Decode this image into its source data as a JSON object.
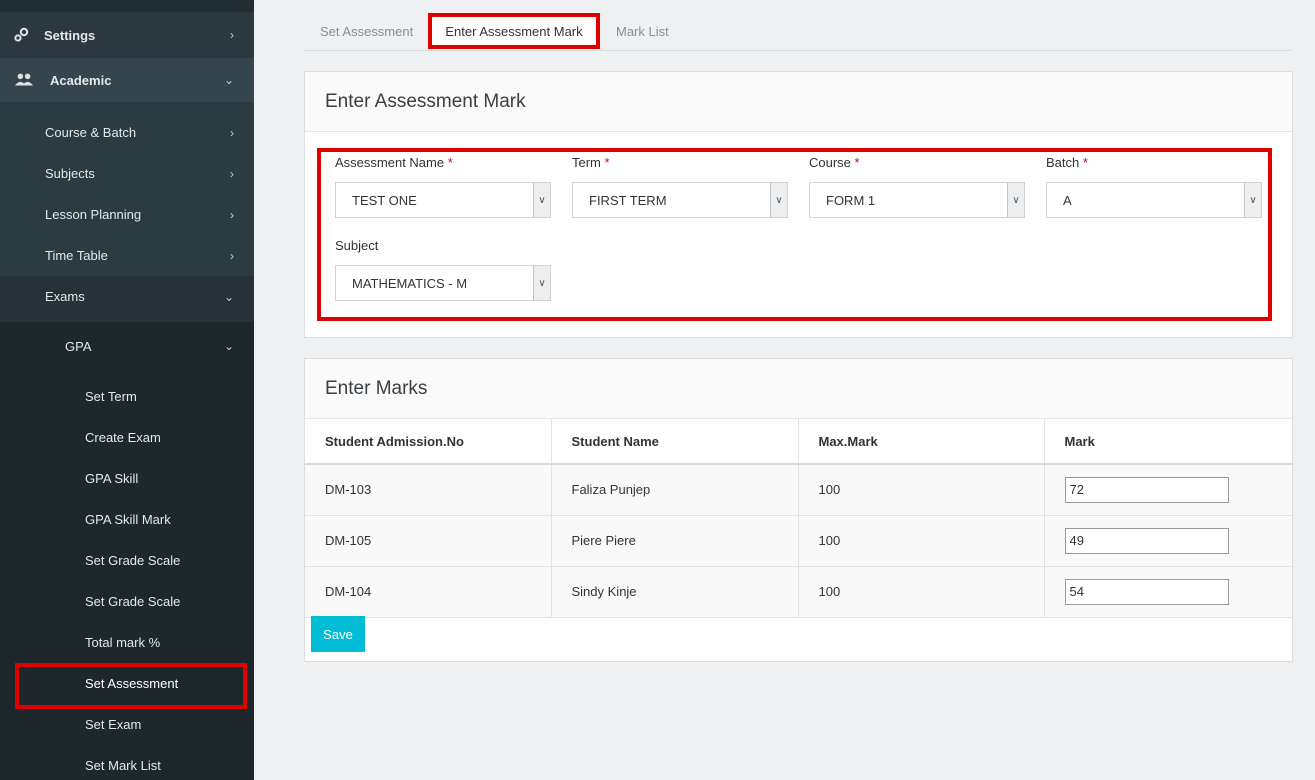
{
  "sidebar": {
    "settings": "Settings",
    "academic": "Academic",
    "course_batch": "Course & Batch",
    "subjects": "Subjects",
    "lesson_planning": "Lesson Planning",
    "time_table": "Time Table",
    "exams": "Exams",
    "gpa": "GPA",
    "gpa_items": [
      "Set Term",
      "Create Exam",
      "GPA Skill",
      "GPA Skill Mark",
      "Set Grade Scale",
      "Set Grade Scale",
      "Total mark %",
      "Set Assessment",
      "Set Exam",
      "Set Mark List"
    ]
  },
  "tabs": [
    "Set Assessment",
    "Enter Assessment Mark",
    "Mark List"
  ],
  "form_panel": {
    "title": "Enter Assessment Mark",
    "required_marker": "*",
    "fields": {
      "assessment_name": {
        "label": "Assessment Name",
        "value": "TEST ONE"
      },
      "term": {
        "label": "Term",
        "value": "FIRST TERM"
      },
      "course": {
        "label": "Course",
        "value": "FORM 1"
      },
      "batch": {
        "label": "Batch",
        "value": "A"
      },
      "subject": {
        "label": "Subject",
        "value": "MATHEMATICS - M"
      }
    }
  },
  "marks_panel": {
    "title": "Enter Marks",
    "columns": [
      "Student Admission.No",
      "Student Name",
      "Max.Mark",
      "Mark"
    ],
    "rows": [
      {
        "admission": "DM-103",
        "name": "Faliza Punjep",
        "max": "100",
        "mark": "72"
      },
      {
        "admission": "DM-105",
        "name": "Piere Piere",
        "max": "100",
        "mark": "49"
      },
      {
        "admission": "DM-104",
        "name": "Sindy Kinje",
        "max": "100",
        "mark": "54"
      }
    ],
    "save_label": "Save"
  },
  "colors": {
    "sidebar_bg": "#222d32",
    "highlight": "#e00000",
    "save_button": "#00bcd4",
    "required": "#d0021b"
  }
}
